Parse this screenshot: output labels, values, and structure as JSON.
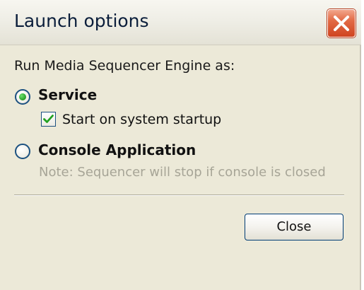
{
  "window": {
    "title": "Launch options"
  },
  "prompt": "Run Media Sequencer Engine as:",
  "options": {
    "service": {
      "label": "Service",
      "selected": true,
      "startup_checkbox": {
        "label": "Start on system startup",
        "checked": true
      }
    },
    "console": {
      "label": "Console Application",
      "selected": false,
      "note": "Note: Sequencer will stop if console is closed"
    }
  },
  "buttons": {
    "close_label": "Close"
  },
  "icons": {
    "window_close": "close-x-icon",
    "radio_selected": "radio-selected-icon",
    "checkbox_checked": "checkmark-icon"
  },
  "colors": {
    "title_close_button": "#e26a45",
    "radio_dot": "#2fa82f",
    "checkmark": "#21a121",
    "note_text": "#a7a597",
    "dialog_background": "#ece9d8"
  }
}
